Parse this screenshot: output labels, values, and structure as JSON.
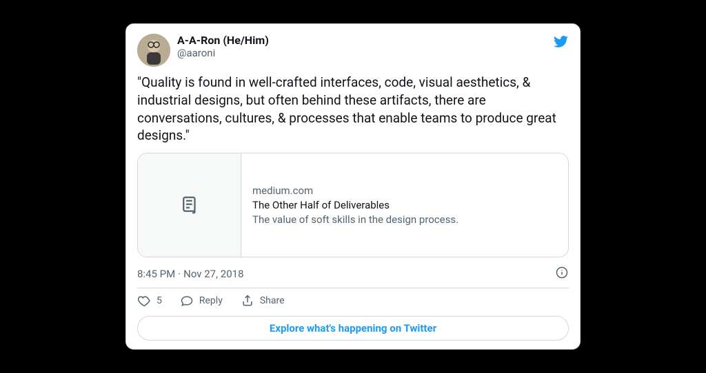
{
  "user": {
    "display_name": "A-A-Ron (He/Him)",
    "handle": "@aaroni"
  },
  "tweet": {
    "text": "\"Quality is found in well-crafted interfaces, code, visual aesthetics, & industrial designs, but often behind these artifacts, there are conversations, cultures, & processes that enable teams to produce great designs.\"",
    "time": "8:45 PM",
    "separator": "·",
    "date": "Nov 27, 2018"
  },
  "link_card": {
    "domain": "medium.com",
    "title": "The Other Half of Deliverables",
    "description": "The value of soft skills in the design process."
  },
  "actions": {
    "like_count": "5",
    "reply_label": "Reply",
    "share_label": "Share"
  },
  "cta": {
    "explore_label": "Explore what's happening on Twitter"
  }
}
